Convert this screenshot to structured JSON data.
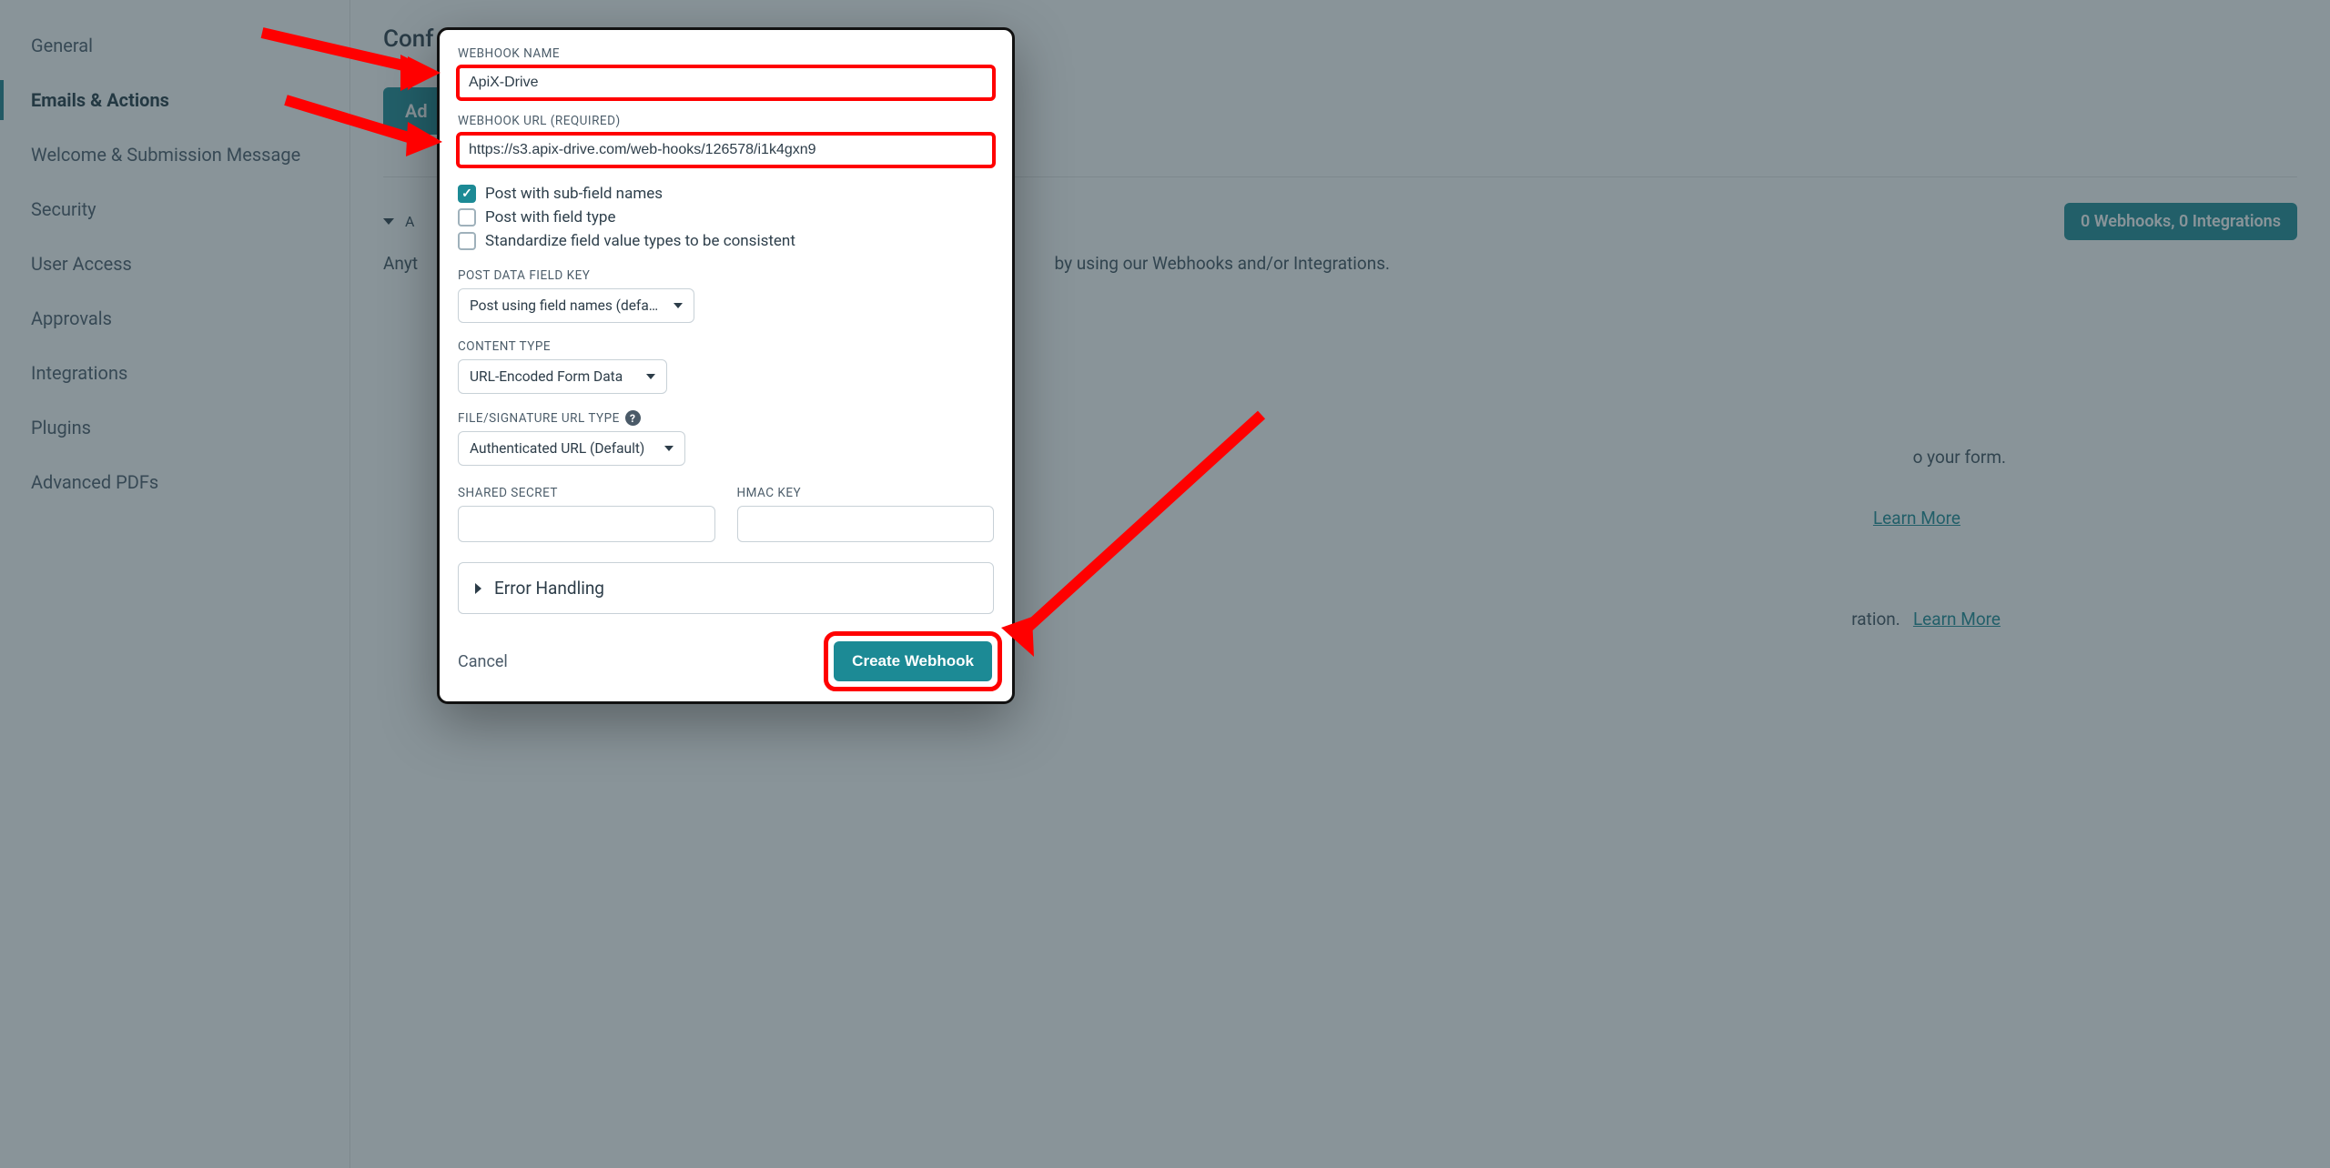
{
  "sidebar": {
    "items": [
      {
        "label": "General"
      },
      {
        "label": "Emails & Actions"
      },
      {
        "label": "Welcome & Submission Message"
      },
      {
        "label": "Security"
      },
      {
        "label": "User Access"
      },
      {
        "label": "Approvals"
      },
      {
        "label": "Integrations"
      },
      {
        "label": "Plugins"
      },
      {
        "label": "Advanced PDFs"
      }
    ]
  },
  "main": {
    "title_prefix": "Conf",
    "add_button_prefix": "Ad",
    "badge": "0 Webhooks, 0 Integrations",
    "line1_prefix": "Anyt",
    "line1_suffix": "by using our Webhooks and/or Integrations.",
    "line2_suffix": "o your form.",
    "learn_more": "Learn More",
    "integration_suffix_a": "ration.",
    "integration_suffix_b": "Learn More"
  },
  "modal": {
    "labels": {
      "name": "WEBHOOK NAME",
      "url": "WEBHOOK URL (REQUIRED)",
      "post_data_key": "POST DATA FIELD KEY",
      "content_type": "CONTENT TYPE",
      "file_sig_url_type": "FILE/SIGNATURE URL TYPE",
      "shared_secret": "SHARED SECRET",
      "hmac_key": "HMAC KEY"
    },
    "values": {
      "name": "ApiX-Drive",
      "url": "https://s3.apix-drive.com/web-hooks/126578/i1k4gxn9",
      "shared_secret": "",
      "hmac_key": ""
    },
    "checkboxes": {
      "subfield": "Post with sub-field names",
      "fieldtype": "Post with field type",
      "standardize": "Standardize field value types to be consistent"
    },
    "selects": {
      "post_data_key": "Post using field names (default)",
      "content_type": "URL-Encoded Form Data",
      "file_sig_url_type": "Authenticated URL (Default)"
    },
    "error_handling": "Error Handling",
    "cancel": "Cancel",
    "create": "Create Webhook"
  },
  "colors": {
    "accent": "#1c8a95",
    "annotation": "#ff0000"
  }
}
